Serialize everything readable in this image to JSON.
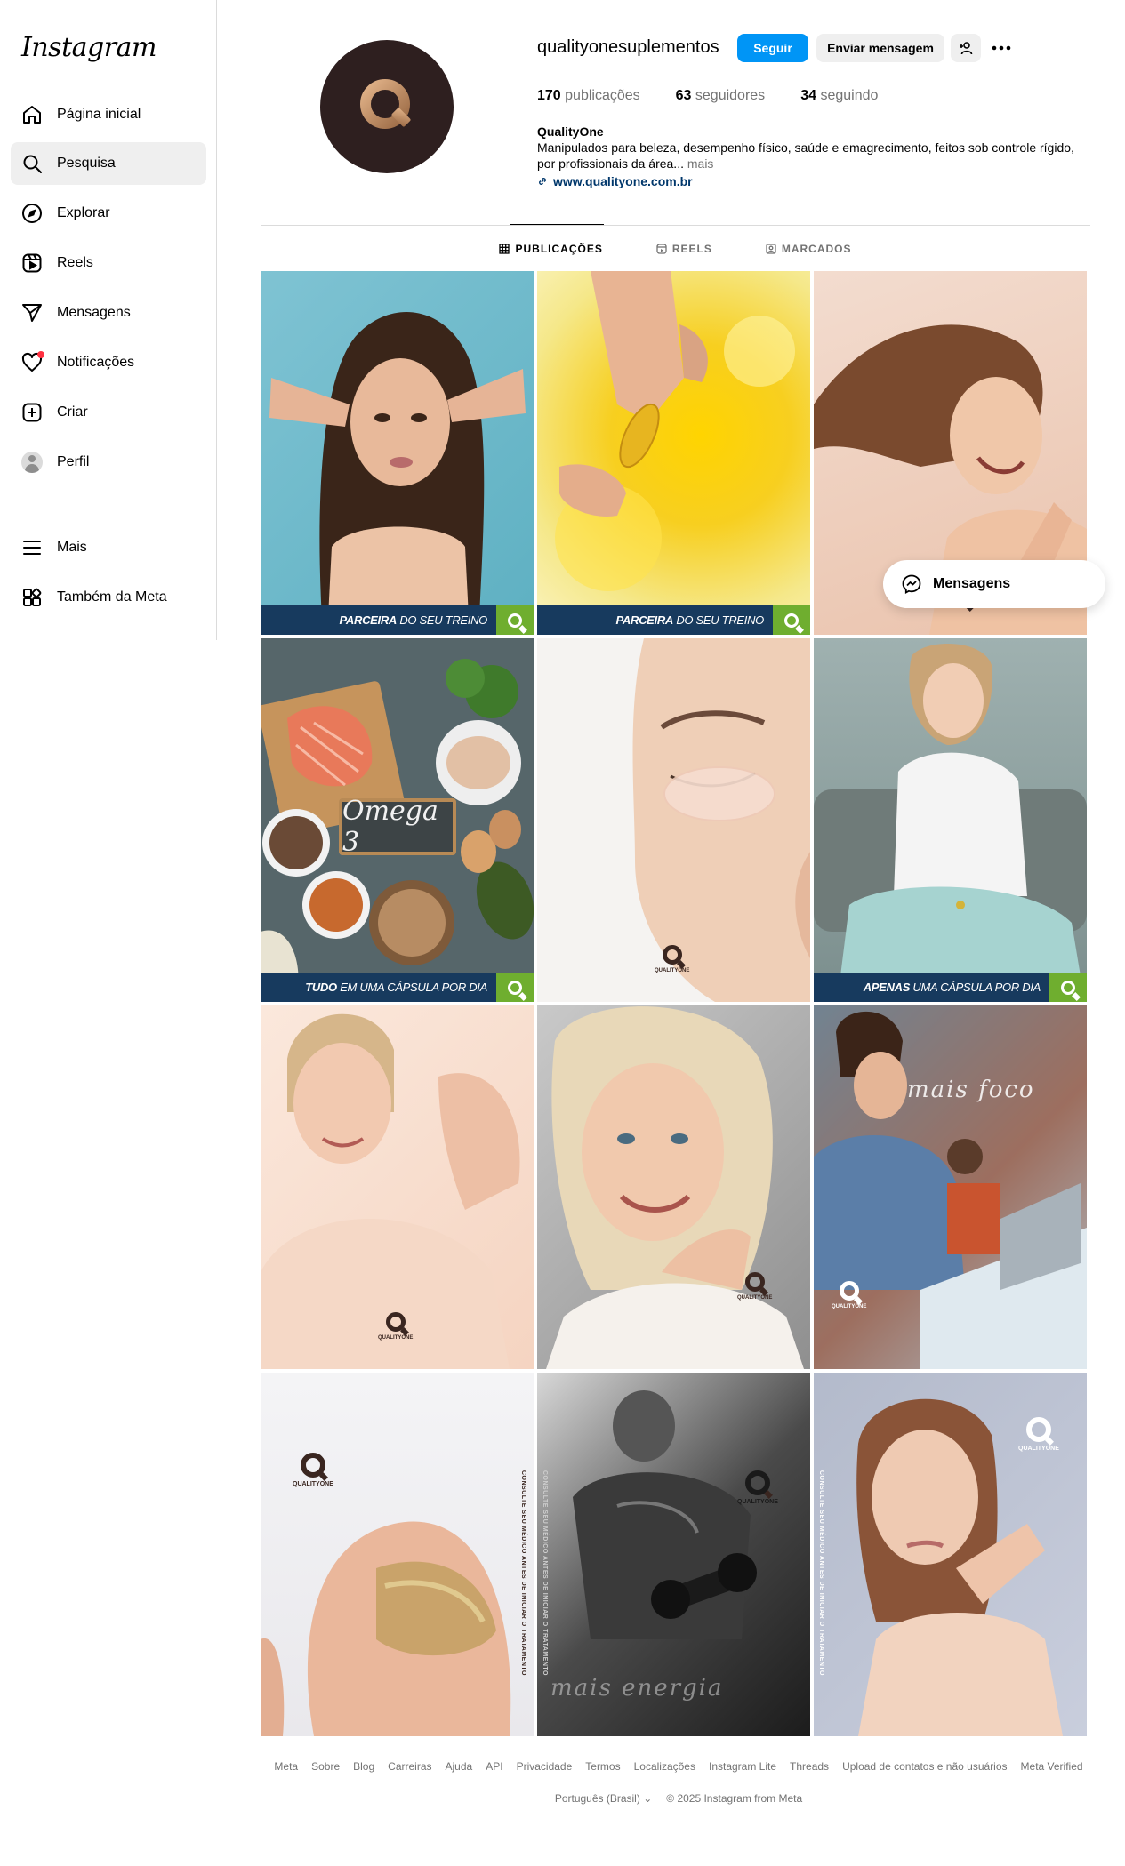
{
  "sidebar": {
    "logo": "Instagram",
    "items": [
      {
        "label": "Página inicial",
        "icon": "home-icon"
      },
      {
        "label": "Pesquisa",
        "icon": "search-icon"
      },
      {
        "label": "Explorar",
        "icon": "compass-icon"
      },
      {
        "label": "Reels",
        "icon": "reels-icon"
      },
      {
        "label": "Mensagens",
        "icon": "send-icon"
      },
      {
        "label": "Notificações",
        "icon": "heart-icon"
      },
      {
        "label": "Criar",
        "icon": "plus-square-icon"
      },
      {
        "label": "Perfil",
        "icon": "avatar-icon"
      },
      {
        "label": "Mais",
        "icon": "menu-icon"
      },
      {
        "label": "Também da Meta",
        "icon": "meta-apps-icon"
      }
    ]
  },
  "profile": {
    "username": "qualityonesuplementos",
    "follow_label": "Seguir",
    "message_label": "Enviar mensagem",
    "stats": {
      "posts_count": "170",
      "posts_label": "publicações",
      "followers_count": "63",
      "followers_label": "seguidores",
      "following_count": "34",
      "following_label": "seguindo"
    },
    "bio": {
      "name": "QualityOne",
      "text": "Manipulados para beleza, desempenho físico, saúde e emagrecimento, feitos sob controle rígido,",
      "text2": "por profissionais da área...",
      "more": "mais",
      "link": "www.qualityone.com.br"
    }
  },
  "tabs": [
    {
      "label": "PUBLICAÇÕES",
      "active": true
    },
    {
      "label": "REELS",
      "active": false
    },
    {
      "label": "MARCADOS",
      "active": false
    }
  ],
  "posts": {
    "p1": {
      "banner_bold": "PARCEIRA",
      "banner_rest": "DO SEU TREINO"
    },
    "p2": {
      "banner_bold": "PARCEIRA",
      "banner_rest": "DO SEU TREINO"
    },
    "p4": {
      "banner_bold": "TUDO",
      "banner_rest": "EM UMA CÁPSULA POR DIA",
      "board": "Omega 3"
    },
    "p6": {
      "banner_bold": "APENAS",
      "banner_rest": "UMA CÁPSULA POR DIA"
    },
    "p9": {
      "script": "mais foco"
    },
    "p11": {
      "script": "mais energia"
    },
    "brand": "QUALITYONE",
    "vertical_note": "CONSULTE SEU MÉDICO ANTES DE INICIAR O TRATAMENTO"
  },
  "floating_messages": {
    "label": "Mensagens"
  },
  "footer": {
    "links": [
      "Meta",
      "Sobre",
      "Blog",
      "Carreiras",
      "Ajuda",
      "API",
      "Privacidade",
      "Termos",
      "Localizações",
      "Instagram Lite",
      "Threads",
      "Upload de contatos e não usuários",
      "Meta Verified"
    ],
    "language": "Português (Brasil)",
    "copyright": "© 2025 Instagram from Meta"
  },
  "colors": {
    "accent": "#0095f6",
    "brand_dark": "#2e1f1f",
    "brand_gold": "#c8956a",
    "banner_navy": "#173a5e",
    "banner_green": "#6fae2f"
  }
}
